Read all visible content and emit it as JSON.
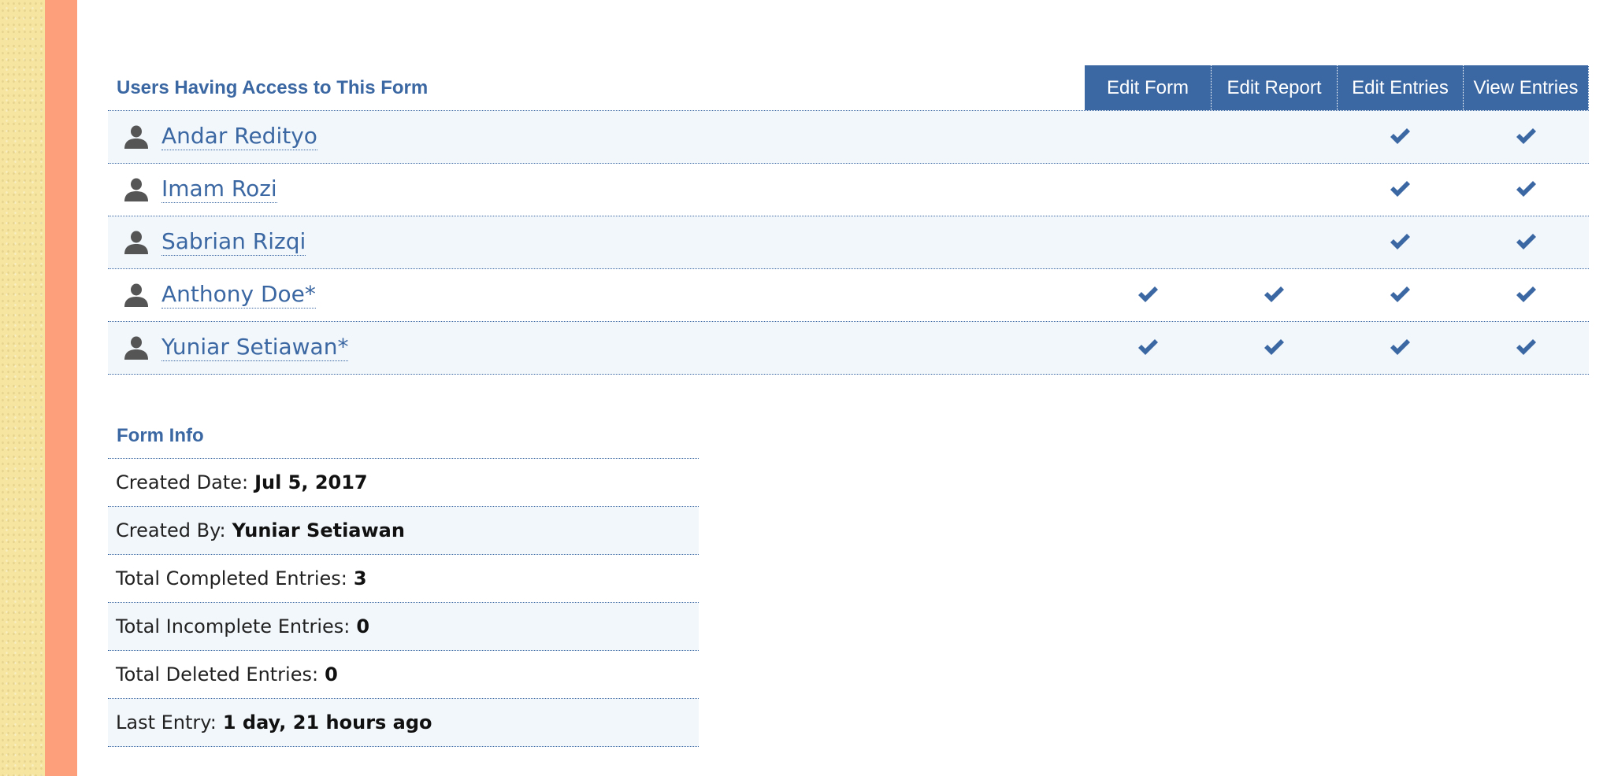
{
  "access": {
    "title": "Users Having Access to This Form",
    "permissions": [
      "Edit Form",
      "Edit Report",
      "Edit Entries",
      "View Entries"
    ],
    "users": [
      {
        "name": "Andar Redityo",
        "perms": [
          false,
          false,
          true,
          true
        ]
      },
      {
        "name": "Imam Rozi",
        "perms": [
          false,
          false,
          true,
          true
        ]
      },
      {
        "name": "Sabrian Rizqi",
        "perms": [
          false,
          false,
          true,
          true
        ]
      },
      {
        "name": "Anthony Doe*",
        "perms": [
          true,
          true,
          true,
          true
        ]
      },
      {
        "name": "Yuniar Setiawan*",
        "perms": [
          true,
          true,
          true,
          true
        ]
      }
    ]
  },
  "info": {
    "title": "Form Info",
    "rows": [
      {
        "label": "Created Date:",
        "value": "Jul 5, 2017"
      },
      {
        "label": "Created By:",
        "value": "Yuniar Setiawan"
      },
      {
        "label": "Total Completed Entries:",
        "value": "3"
      },
      {
        "label": "Total Incomplete Entries:",
        "value": "0"
      },
      {
        "label": "Total Deleted Entries:",
        "value": "0"
      },
      {
        "label": "Last Entry:",
        "value": "1 day, 21 hours ago"
      }
    ]
  },
  "icons": {
    "user": "user-icon",
    "check": "checkmark-icon"
  },
  "colors": {
    "accent": "#3b67a2",
    "row_shade": "#f2f7fc",
    "side_band": "#fe9f7c",
    "paper": "#f5e5a0",
    "check": "#3b67a2"
  }
}
